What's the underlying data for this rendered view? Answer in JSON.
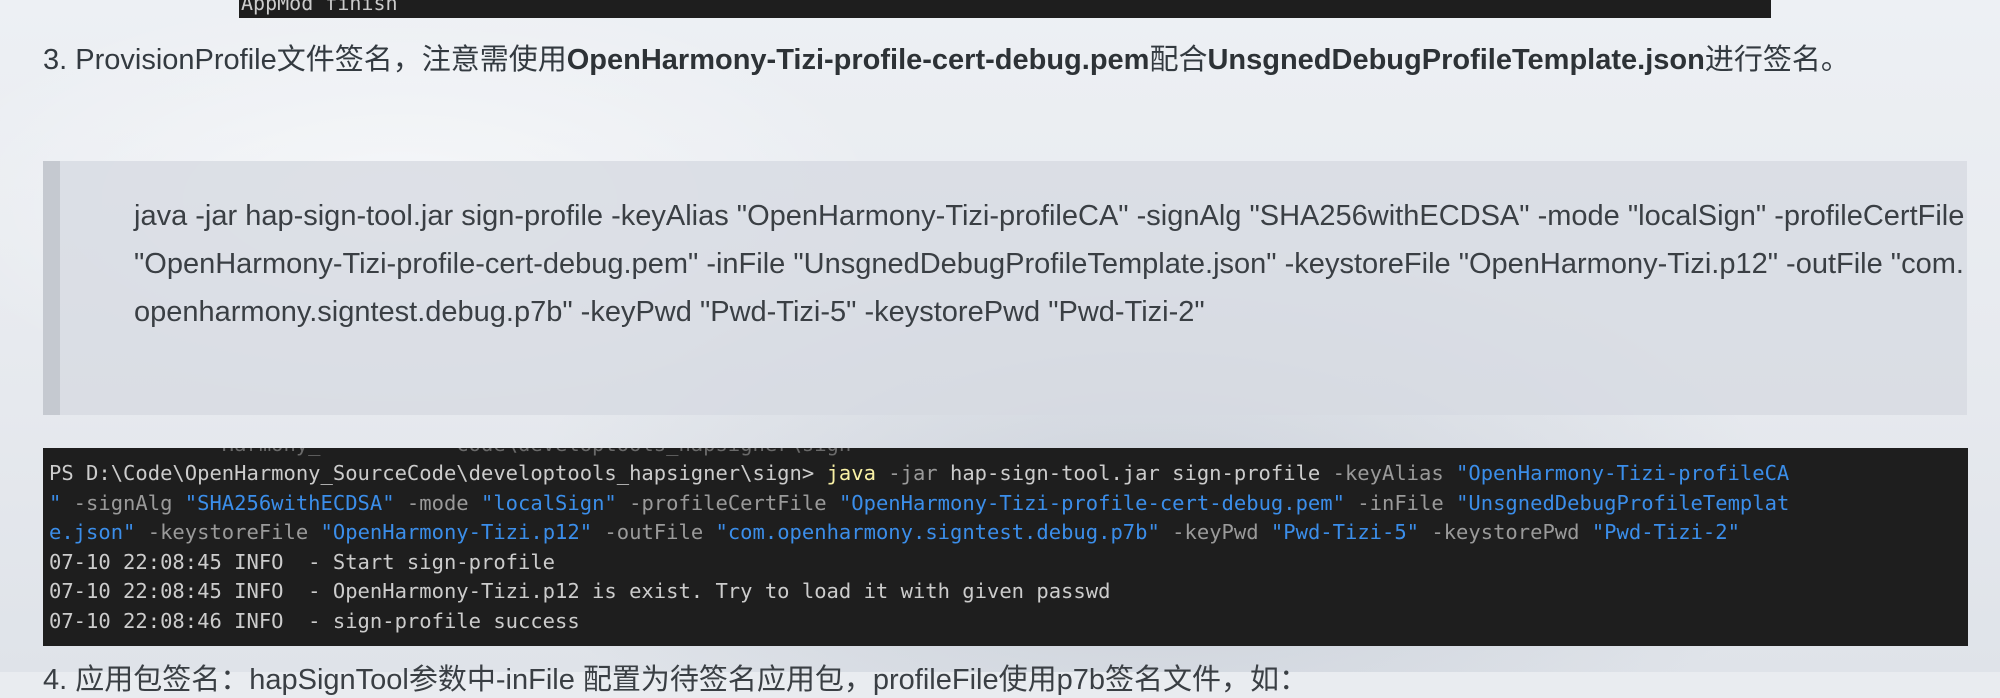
{
  "top_terminal": {
    "text": "AppMod finish"
  },
  "step": {
    "prefix": "3. ProvisionProfile文件签名，注意需使用",
    "bold1": "OpenHarmony-Tizi-profile-cert-debug.pem",
    "middle": "配合",
    "bold2": "UnsgnedDebugProfileTemplate.json",
    "suffix": "进行签名。"
  },
  "quote": {
    "command": "java -jar hap-sign-tool.jar sign-profile -keyAlias \"OpenHarmony-Tizi-profileCA\" -signAlg \"SHA256withECDSA\" -mode \"localSign\" -profileCertFile \"OpenHarmony-Tizi-profile-cert-debug.pem\" -inFile \"UnsgnedDebugProfileTemplate.json\" -keystoreFile \"OpenHarmony-Tizi.p12\" -outFile \"com.openharmony.signtest.debug.p7b\" -keyPwd \"Pwd-Tizi-5\" -keystorePwd \"Pwd-Tizi-2\""
  },
  "terminal": {
    "ghost_line": "              Harmony_           Code\\developtools_hapsigner\\sign",
    "line1": {
      "prompt": "PS D:\\Code\\OpenHarmony_SourceCode\\developtools_hapsigner\\sign> ",
      "cmd": "java",
      "p_jar": " -jar ",
      "jar": "hap-sign-tool.jar sign-profile ",
      "p_keyAlias": "-keyAlias ",
      "v_keyAlias_a": "\"OpenHarmony-Tizi-profileCA"
    },
    "line2": {
      "v_keyAlias_b": "\"",
      "p_signAlg": " -signAlg ",
      "v_signAlg": "\"SHA256withECDSA\"",
      "p_mode": " -mode ",
      "v_mode": "\"localSign\"",
      "p_profileCertFile": " -profileCertFile ",
      "v_profileCertFile": "\"OpenHarmony-Tizi-profile-cert-debug.pem\"",
      "p_inFile": " -inFile ",
      "v_inFile_a": "\"UnsgnedDebugProfileTemplat"
    },
    "line3": {
      "v_inFile_b": "e.json\"",
      "p_keystoreFile": " -keystoreFile ",
      "v_keystoreFile": "\"OpenHarmony-Tizi.p12\"",
      "p_outFile": " -outFile ",
      "v_outFile": "\"com.openharmony.signtest.debug.p7b\"",
      "p_keyPwd": " -keyPwd ",
      "v_keyPwd": "\"Pwd-Tizi-5\"",
      "p_keystorePwd": " -keystorePwd ",
      "v_keystorePwd": "\"Pwd-Tizi-2\""
    },
    "log": [
      "07-10 22:08:45 INFO  - Start sign-profile",
      "07-10 22:08:45 INFO  - OpenHarmony-Tizi.p12 is exist. Try to load it with given passwd",
      "07-10 22:08:46 INFO  - sign-profile success"
    ]
  },
  "bottom_text": "4. 应用包签名：hapSignTool参数中-inFile 配置为待签名应用包，profileFile使用p7b签名文件，如："
}
